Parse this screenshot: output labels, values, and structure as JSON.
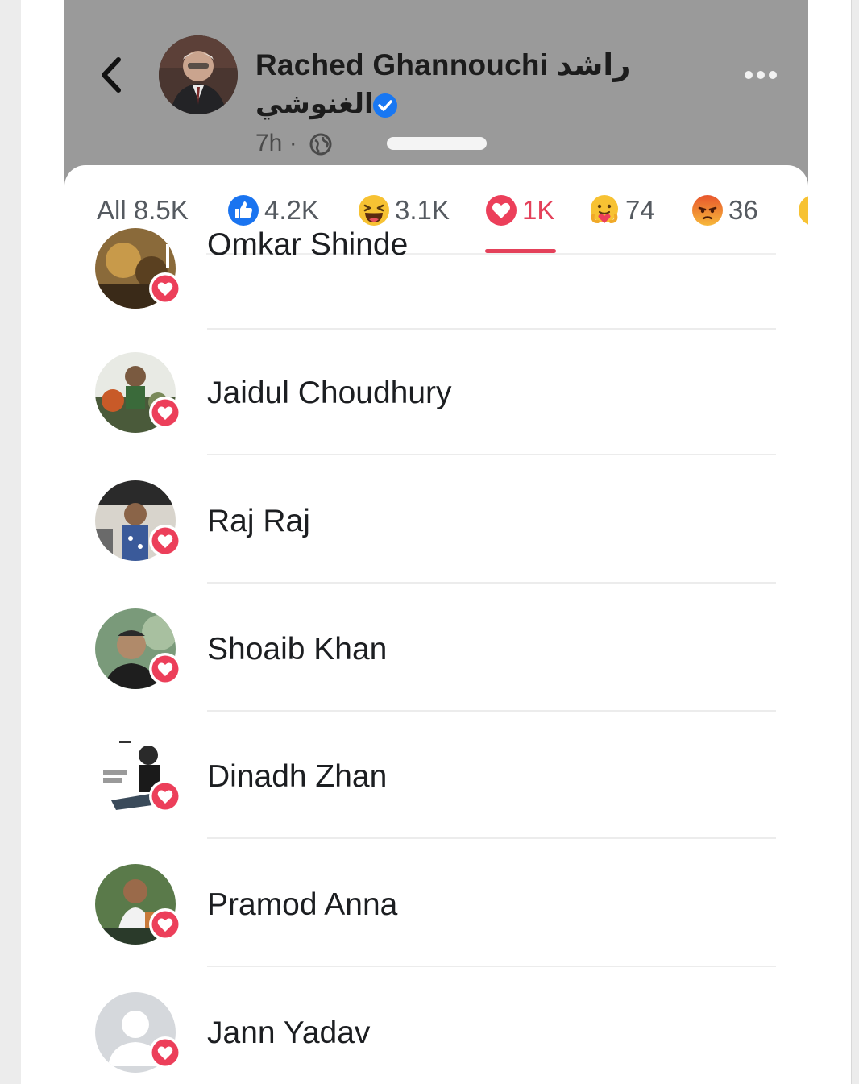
{
  "post": {
    "author_name": "Rached Ghannouchi راشد",
    "author_name_line2": "الغنوشي",
    "time": "7h ·",
    "verified": true,
    "colors": {
      "overlay": "#9a9a9a",
      "verified": "#1877f2"
    }
  },
  "reactions": {
    "tabs": [
      {
        "icon": "none",
        "label": "All 8.5K"
      },
      {
        "icon": "like-icon",
        "label": "4.2K"
      },
      {
        "icon": "haha-icon",
        "label": "3.1K"
      },
      {
        "icon": "love-icon",
        "label": "1K"
      },
      {
        "icon": "care-icon",
        "label": "74"
      },
      {
        "icon": "angry-icon",
        "label": "36"
      }
    ],
    "active_tab": "1K",
    "accent_color": "#e4415a"
  },
  "people": [
    {
      "name": "Omkar Shinde",
      "reaction": "love"
    },
    {
      "name": "Jaidul Choudhury",
      "reaction": "love"
    },
    {
      "name": "Raj Raj",
      "reaction": "love"
    },
    {
      "name": "Shoaib Khan",
      "reaction": "love"
    },
    {
      "name": "Dinadh Zhan",
      "reaction": "love"
    },
    {
      "name": "Pramod Anna",
      "reaction": "love"
    },
    {
      "name": "Jann Yadav",
      "reaction": "love"
    }
  ]
}
